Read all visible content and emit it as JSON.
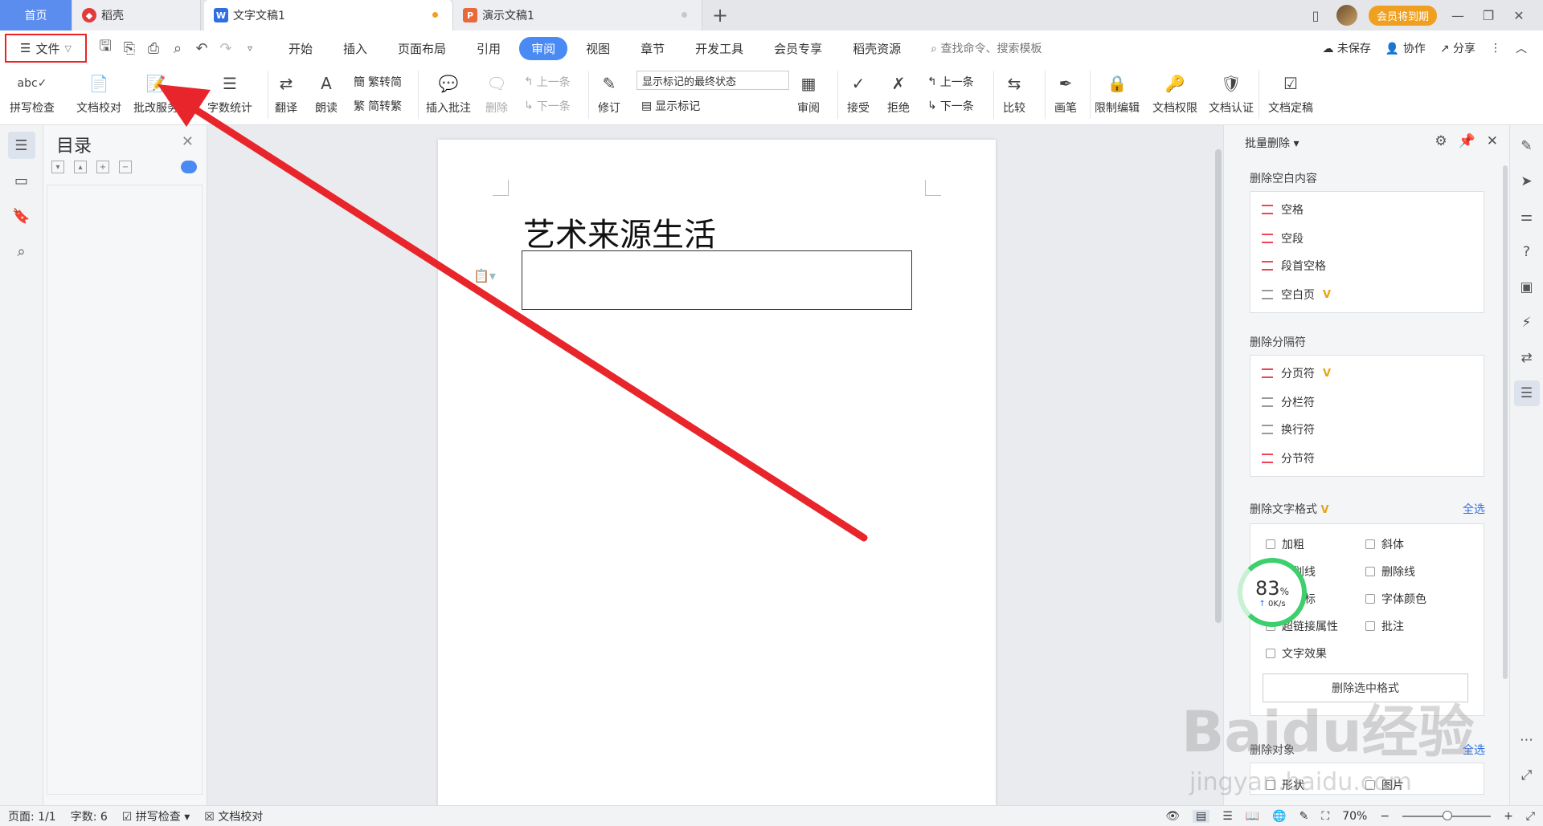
{
  "tabs": [
    {
      "label": "首页"
    },
    {
      "label": "稻壳"
    },
    {
      "label": "文字文稿1"
    },
    {
      "label": "演示文稿1"
    }
  ],
  "titlebar": {
    "vip_badge": "会员将到期"
  },
  "menu": {
    "file_label": "文件",
    "tabs": [
      "开始",
      "插入",
      "页面布局",
      "引用",
      "审阅",
      "视图",
      "章节",
      "开发工具",
      "会员专享",
      "稻壳资源"
    ],
    "active_tab": "审阅",
    "search_placeholder": "查找命令、搜索模板",
    "unsaved": "未保存",
    "collab": "协作",
    "share": "分享"
  },
  "ribbon": {
    "spellcheck": "拼写检查",
    "doc_proof": "文档校对",
    "revise": "批改服务",
    "word_count": "字数统计",
    "translate": "翻译",
    "read_aloud": "朗读",
    "trad_to_simp": "繁转简",
    "simp_to_trad": "简转繁",
    "insert_comment": "插入批注",
    "delete": "删除",
    "prev_comment": "上一条",
    "next_comment": "下一条",
    "revision": "修订",
    "markup_state": "显示标记的最终状态",
    "show_markup": "显示标记",
    "review": "审阅",
    "accept": "接受",
    "reject": "拒绝",
    "prev_change": "上一条",
    "next_change": "下一条",
    "compare": "比较",
    "pen": "画笔",
    "restrict_edit": "限制编辑",
    "doc_permission": "文档权限",
    "doc_auth": "文档认证",
    "doc_finalize": "文档定稿"
  },
  "toc": {
    "title": "目录"
  },
  "document": {
    "title": "艺术来源生活"
  },
  "panel": {
    "header": "批量删除",
    "sec1": "删除空白内容",
    "sec1_items": [
      "空格",
      "空段",
      "段首空格",
      "空白页"
    ],
    "sec2": "删除分隔符",
    "sec2_items": [
      "分页符",
      "分栏符",
      "换行符",
      "分节符"
    ],
    "sec3": "删除文字格式",
    "select_all": "全选",
    "sec3_items": [
      "加粗",
      "斜体",
      "下划线",
      "删除线",
      "上下标",
      "字体颜色",
      "超链接属性",
      "批注",
      "文字效果"
    ],
    "delete_selected_format": "删除选中格式",
    "sec4": "删除对象",
    "sec4_items": [
      "形状",
      "图片"
    ]
  },
  "gauge": {
    "percent": "83",
    "unit": "%",
    "speed": "0K/s"
  },
  "status": {
    "page": "页面: 1/1",
    "word_count": "字数: 6",
    "spellcheck": "拼写检查",
    "doc_proof": "文档校对",
    "zoom": "70%"
  },
  "watermark": {
    "brand": "Baidu经验",
    "url": "jingyan.baidu.com"
  },
  "colors": {
    "accent": "#4a8af4",
    "annotation_red": "#e8252b",
    "vip": "#f0a020",
    "gauge_green": "#3ccf6b"
  }
}
